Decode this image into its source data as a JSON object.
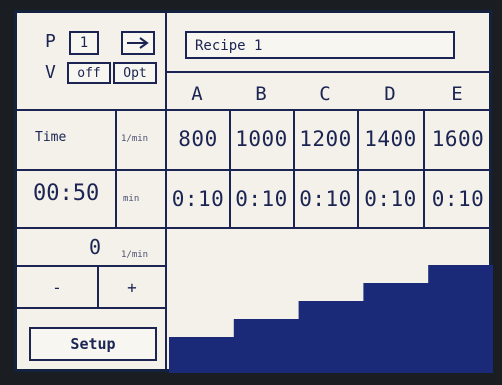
{
  "header": {
    "program_label": "P",
    "program_number": "1",
    "v_label": "V",
    "off_label": "off",
    "opt_label": "Opt",
    "recipe_name": "Recipe 1"
  },
  "columns": [
    "A",
    "B",
    "C",
    "D",
    "E"
  ],
  "rows": {
    "speed": [
      "800",
      "1000",
      "1200",
      "1400",
      "1600"
    ],
    "time": [
      "0:10",
      "0:10",
      "0:10",
      "0:10",
      "0:10"
    ]
  },
  "left_panel": {
    "time_label": "Time",
    "time_value": "00:50",
    "speed_unit": "1/min",
    "time_unit": "min",
    "current_speed": "0",
    "current_speed_unit": "1/min",
    "minus_label": "-",
    "plus_label": "+",
    "setup_label": "Setup"
  },
  "colors": {
    "bar_fill": "#1a2a78",
    "line": "#1b2452",
    "background": "#f3f1ea"
  },
  "chart_data": {
    "type": "area",
    "x": [
      "A",
      "B",
      "C",
      "D",
      "E"
    ],
    "values": [
      800,
      1000,
      1200,
      1400,
      1600
    ],
    "title": "",
    "xlabel": "",
    "ylabel": ""
  }
}
